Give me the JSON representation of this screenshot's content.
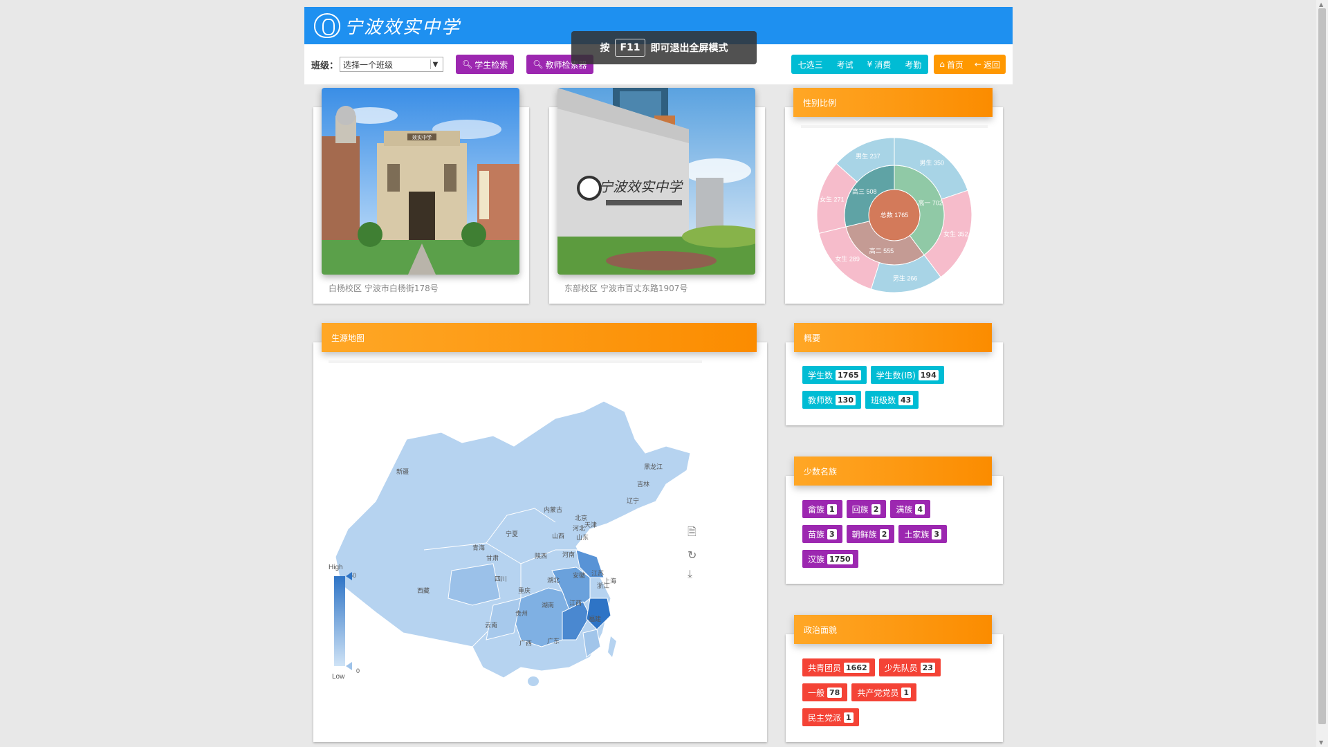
{
  "header": {
    "logo_text": "宁波效实中学"
  },
  "toast": {
    "prefix": "按",
    "key": "F11",
    "suffix": "即可退出全屏模式"
  },
  "toolbar": {
    "class_label": "班级：",
    "class_select_value": "选择一个班级",
    "student_search": "学生检索",
    "teacher_search": "教师检索器",
    "nav": [
      "七选三",
      "考试",
      "消费",
      "考勤"
    ],
    "home": "首页",
    "back": "返回"
  },
  "campuses": [
    {
      "caption": "白杨校区 宁波市白杨街178号",
      "gate_sign": "效实中学"
    },
    {
      "caption": "东部校区 宁波市百丈东路1907号",
      "wall_sign": "宁波效实中学"
    }
  ],
  "gender": {
    "title": "性别比例",
    "center": {
      "label": "总数",
      "value": 1765
    },
    "grades": [
      {
        "label": "高一",
        "value": 702
      },
      {
        "label": "高二",
        "value": 555
      },
      {
        "label": "高三",
        "value": 508
      }
    ],
    "outer": [
      {
        "label": "男生",
        "value": 350
      },
      {
        "label": "女生",
        "value": 352
      },
      {
        "label": "男生",
        "value": 266
      },
      {
        "label": "女生",
        "value": 289
      },
      {
        "label": "女生",
        "value": 271
      },
      {
        "label": "男生",
        "value": 237
      }
    ]
  },
  "map": {
    "title": "生源地图",
    "visual_map": {
      "high": "High",
      "low": "Low",
      "max": "50",
      "min": "0"
    },
    "provinces": [
      "新疆",
      "西藏",
      "青海",
      "甘肃",
      "宁夏",
      "内蒙古",
      "黑龙江",
      "吉林",
      "辽宁",
      "北京",
      "天津",
      "河北",
      "山西",
      "山东",
      "河南",
      "陕西",
      "四川",
      "重庆",
      "湖北",
      "安徽",
      "江苏",
      "上海",
      "浙江",
      "江西",
      "湖南",
      "贵州",
      "云南",
      "广西",
      "广东",
      "福建"
    ],
    "tools": [
      "data-view-icon",
      "restore-icon",
      "save-image-icon"
    ]
  },
  "summary": {
    "title": "概要",
    "items": [
      {
        "label": "学生数",
        "count": "1765"
      },
      {
        "label": "学生数(IB)",
        "count": "194"
      },
      {
        "label": "教师数",
        "count": "130"
      },
      {
        "label": "班级数",
        "count": "43"
      }
    ]
  },
  "minority": {
    "title": "少数名族",
    "items": [
      {
        "label": "畲族",
        "count": "1"
      },
      {
        "label": "回族",
        "count": "2"
      },
      {
        "label": "满族",
        "count": "4"
      },
      {
        "label": "苗族",
        "count": "3"
      },
      {
        "label": "朝鲜族",
        "count": "2"
      },
      {
        "label": "土家族",
        "count": "3"
      },
      {
        "label": "汉族",
        "count": "1750"
      }
    ]
  },
  "political": {
    "title": "政治面貌",
    "items": [
      {
        "label": "共青团员",
        "count": "1662"
      },
      {
        "label": "少先队员",
        "count": "23"
      },
      {
        "label": "一般",
        "count": "78"
      },
      {
        "label": "共产党党员",
        "count": "1"
      },
      {
        "label": "民主党派",
        "count": "1"
      }
    ]
  },
  "colors": {
    "header_blue": "#1e90f0",
    "purple": "#9c27b0",
    "teal": "#00bcd4",
    "orange": "#ff9800",
    "red": "#f44336"
  }
}
